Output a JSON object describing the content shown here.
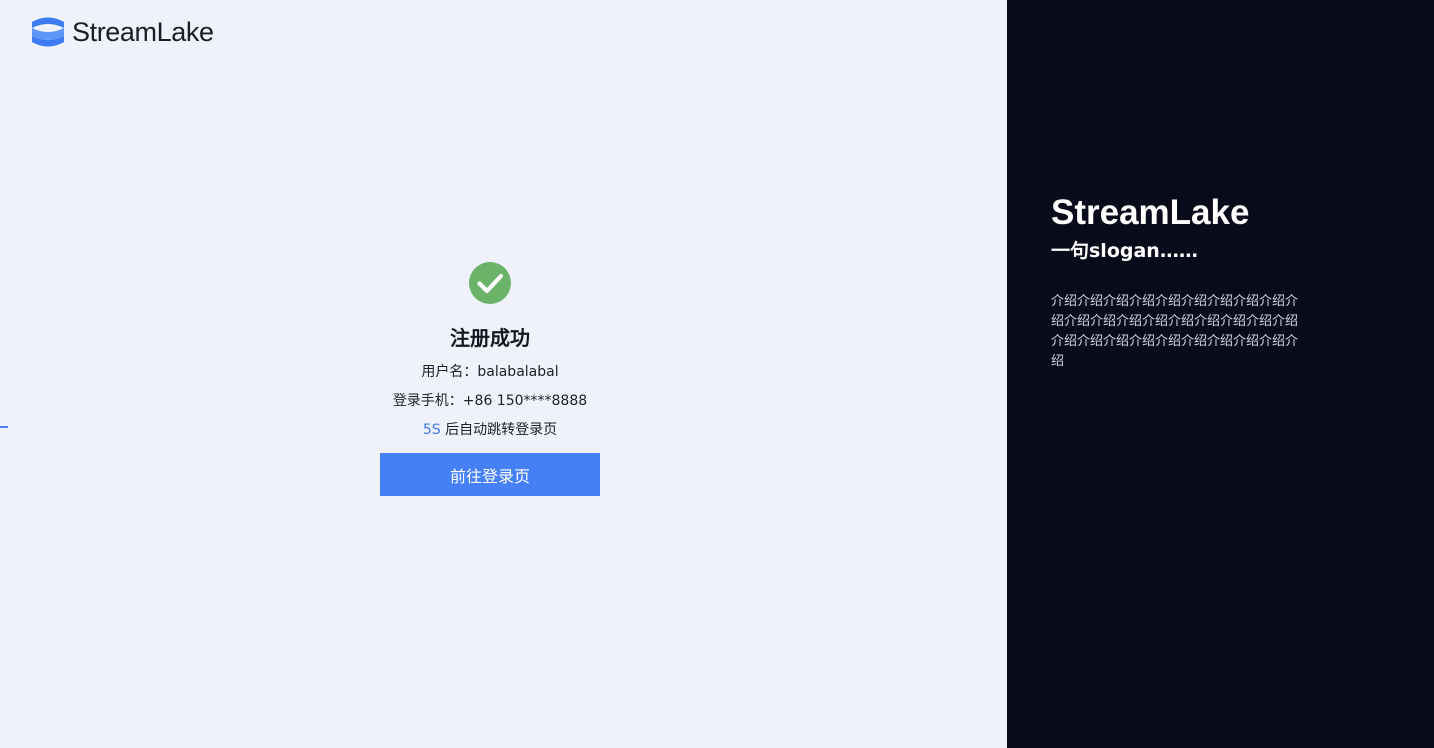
{
  "brand": {
    "logo_text": "StreamLake",
    "accent_color": "#4580f7",
    "success_color": "#6cb36a"
  },
  "success_panel": {
    "title": "注册成功",
    "username_line": "用户名：balabalabal",
    "phone_line": "登录手机：+86 150****8888",
    "countdown": "5S",
    "redirect_text": " 后自动跳转登录页",
    "button_label": "前往登录页",
    "icon": "check-circle-icon"
  },
  "side_panel": {
    "title": "StreamLake",
    "slogan": "一句slogan……",
    "intro": "介绍介绍介绍介绍介绍介绍介绍介绍介绍介绍介绍介绍介绍介绍介绍介绍介绍介绍介绍介绍介绍介绍介绍介绍介绍介绍介绍介绍介绍"
  }
}
